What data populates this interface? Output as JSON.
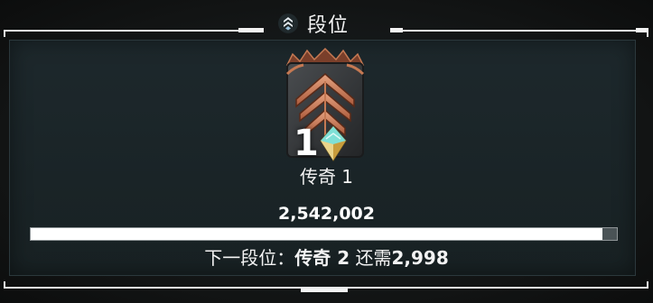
{
  "header": {
    "title": "段位",
    "icon": "rank-chevron-icon"
  },
  "rank": {
    "emblem_icon": "rank-crest-icon",
    "number": "1",
    "gem_icon": "diamond-gem-icon",
    "name": "传奇 1"
  },
  "score": "2,542,002",
  "progress": {
    "fraction": 0.976
  },
  "next": {
    "prefix": "下一段位：",
    "rank": "传奇 2",
    "middle": " 还需",
    "remaining": "2,998"
  },
  "colors": {
    "panel": "#1b2629",
    "accent_copper": "#c9835e",
    "frame": "#ececec"
  }
}
